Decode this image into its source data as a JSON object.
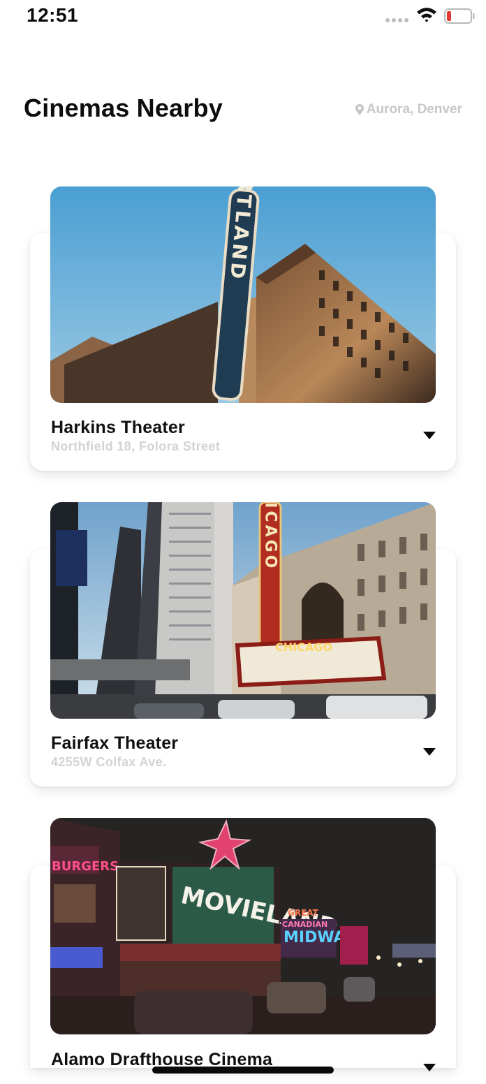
{
  "status_bar": {
    "time": "12:51",
    "battery_color": "#e53935"
  },
  "header": {
    "title": "Cinemas Nearby",
    "location": "Aurora, Denver"
  },
  "cinemas": [
    {
      "name": "Harkins Theater",
      "address": "Northfield 18, Folora Street",
      "image": "portland-theater-photo",
      "sign_text": "PORTLAND"
    },
    {
      "name": "Fairfax Theater",
      "address": "4255W Colfax Ave.",
      "image": "chicago-theater-photo",
      "sign_text": "CHICAGO",
      "marquee_sign": "CHICAGO"
    },
    {
      "name": "Alamo Drafthouse Cinema",
      "address": "",
      "image": "movieland-night-photo",
      "sign_text": "MOVIELAND",
      "neon_signs": [
        "BURGERS",
        "GREAT",
        "CANADIAN",
        "MIDWAY"
      ]
    }
  ]
}
